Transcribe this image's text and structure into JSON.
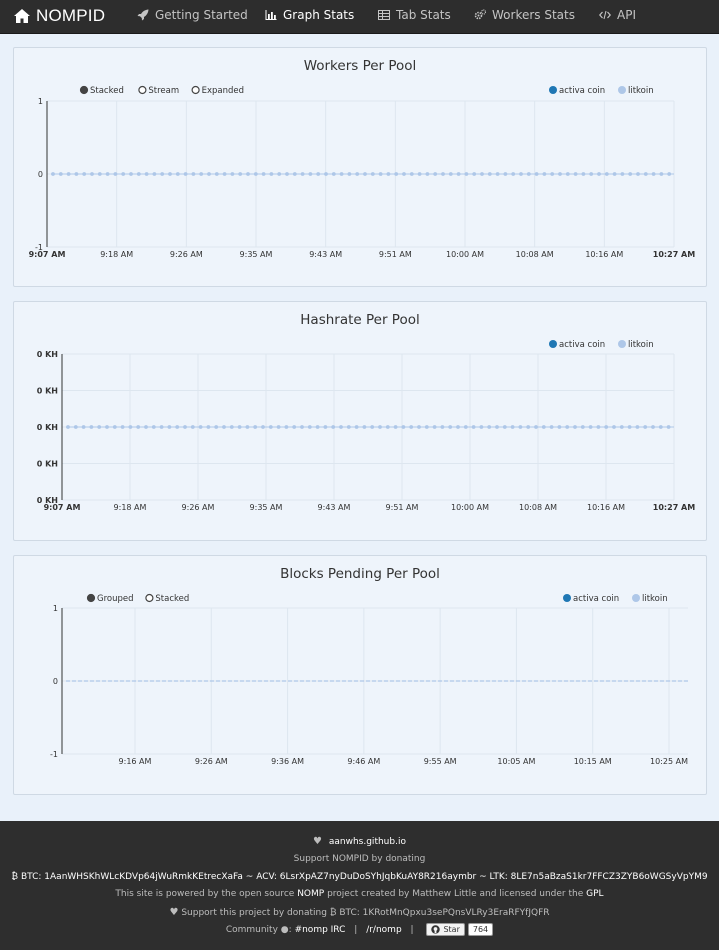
{
  "nav": {
    "brand": "NOMPID",
    "items": [
      {
        "label": "Getting Started",
        "icon": "rocket-icon"
      },
      {
        "label": "Graph Stats",
        "icon": "bar-chart-icon",
        "active": true
      },
      {
        "label": "Tab Stats",
        "icon": "table-icon"
      },
      {
        "label": "Workers Stats",
        "icon": "gears-icon"
      },
      {
        "label": "API",
        "icon": "code-icon"
      }
    ]
  },
  "colors": {
    "navbar": "#2d2d2d",
    "series_activa": "#1f77b4",
    "series_litkoin": "#aec7e8",
    "background": "#e9f1fa"
  },
  "legend": {
    "series": [
      "activa coin",
      "litkoin"
    ]
  },
  "charts": {
    "workers": {
      "title": "Workers Per Pool",
      "modes": [
        "Stacked",
        "Stream",
        "Expanded"
      ],
      "selected_mode": "Stacked",
      "yticks": [
        "1",
        "0",
        "-1"
      ],
      "xticks": [
        "9:07 AM",
        "9:18 AM",
        "9:26 AM",
        "9:35 AM",
        "9:43 AM",
        "9:51 AM",
        "10:00 AM",
        "10:08 AM",
        "10:16 AM",
        "10:27 AM"
      ]
    },
    "hashrate": {
      "title": "Hashrate Per Pool",
      "yticks": [
        "0 KH",
        "0 KH",
        "0 KH",
        "0 KH",
        "0 KH"
      ],
      "xticks": [
        "9:07 AM",
        "9:18 AM",
        "9:26 AM",
        "9:35 AM",
        "9:43 AM",
        "9:51 AM",
        "10:00 AM",
        "10:08 AM",
        "10:16 AM",
        "10:27 AM"
      ]
    },
    "blocks": {
      "title": "Blocks Pending Per Pool",
      "modes": [
        "Grouped",
        "Stacked"
      ],
      "selected_mode": "Grouped",
      "yticks": [
        "1",
        "0",
        "-1"
      ],
      "xticks": [
        "9:16 AM",
        "9:26 AM",
        "9:36 AM",
        "9:46 AM",
        "9:55 AM",
        "10:05 AM",
        "10:15 AM",
        "10:25 AM"
      ]
    }
  },
  "footer": {
    "site": "aanwhs.github.io",
    "support": "Support NOMPID by donating",
    "btc_label": "BTC: 1AanWHSKhWLcKDVp64jWuRmkKEtrecXaFa",
    "acv_label": "ACV: 6LsrXpAZ7nyDuDoSYhJqbKuAY8R216aymbr",
    "ltk_label": "LTK: 8LE7n5aBzaS1kr7FFCZ3ZYB6oWGSyVpYM9",
    "tilde": "~",
    "powered_pre": "This site is powered by the open source",
    "powered_link": "NOMP",
    "powered_mid": "project created by Matthew Little and licensed under the",
    "powered_license": "GPL",
    "support2": "Support this project by donating",
    "btc2_label": "BTC: 1KRotMnQpxu3sePQnsVLRy3EraRFYfJQFR",
    "community": "Community",
    "irc": "#nomp IRC",
    "reddit": "/r/nomp",
    "pipe": "|",
    "star": "Star",
    "star_count": "764"
  }
}
